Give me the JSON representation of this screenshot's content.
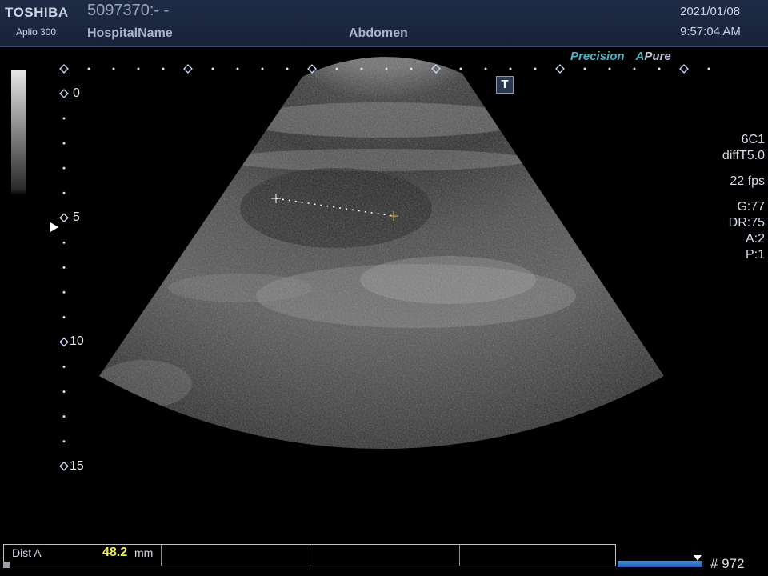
{
  "header": {
    "brand": "TOSHIBA",
    "model": "Aplio 300",
    "patient_id": "5097370:- -",
    "hospital": "HospitalName",
    "exam": "Abdomen",
    "date": "2021/01/08",
    "time": "9:57:04 AM"
  },
  "depth_scale": {
    "labels": [
      "0",
      "5",
      "10",
      "15"
    ],
    "unit_hint": "cm"
  },
  "logo": {
    "precision": "Precision",
    "a": "A",
    "pure": "Pure"
  },
  "t_button_label": "T",
  "parameters": {
    "probe": "6C1",
    "mode": "diffT5.0",
    "frame_rate": "22 fps",
    "gain": "G:77",
    "dynamic_range": "DR:75",
    "a": "A:2",
    "p": "P:1"
  },
  "measurement": {
    "label": "Dist A",
    "value": "48.2",
    "unit": "mm"
  },
  "cine": {
    "frame": "# 972",
    "position_fraction": 0.94
  },
  "colors": {
    "header_bg": "#1f2b45",
    "measurement_value": "#f4f14a",
    "logo_accent": "#4fb3bf",
    "cine_bar": "#2f74c9"
  }
}
